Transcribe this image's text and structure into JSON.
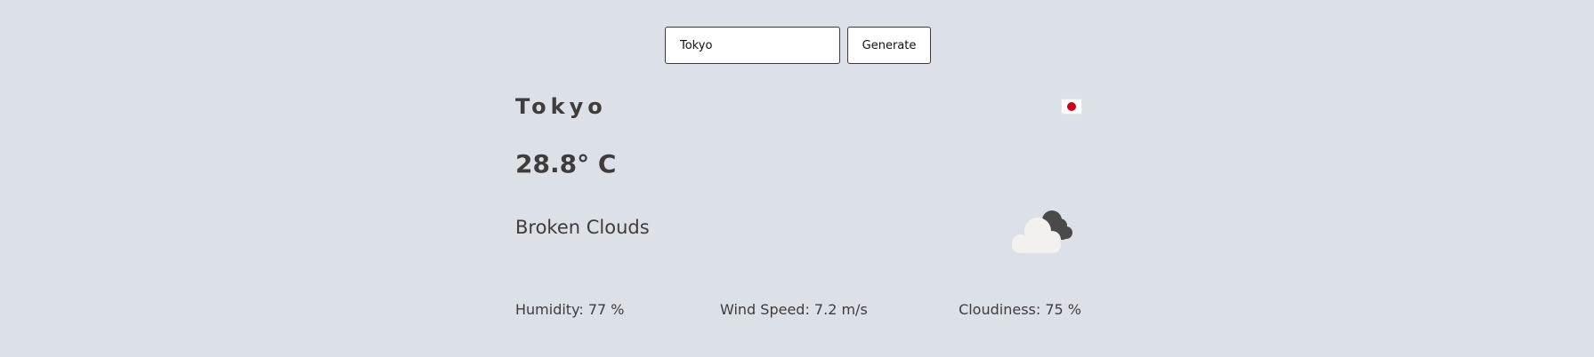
{
  "search": {
    "value": "Tokyo",
    "button_label": "Generate"
  },
  "weather": {
    "city": "Tokyo",
    "country_flag_icon": "japan-flag-icon",
    "temperature": "28.8° C",
    "description": "Broken Clouds",
    "condition_icon": "broken-clouds-icon",
    "humidity": "Humidity: 77 %",
    "wind_speed": "Wind Speed: 7.2 m/s",
    "cloudiness": "Cloudiness: 75 %"
  },
  "colors": {
    "background": "#dce0e7",
    "text": "#3f3c3c",
    "flag_red": "#d0021b",
    "cloud_dark": "#4a4a4a",
    "cloud_light": "#f2f1ef"
  }
}
